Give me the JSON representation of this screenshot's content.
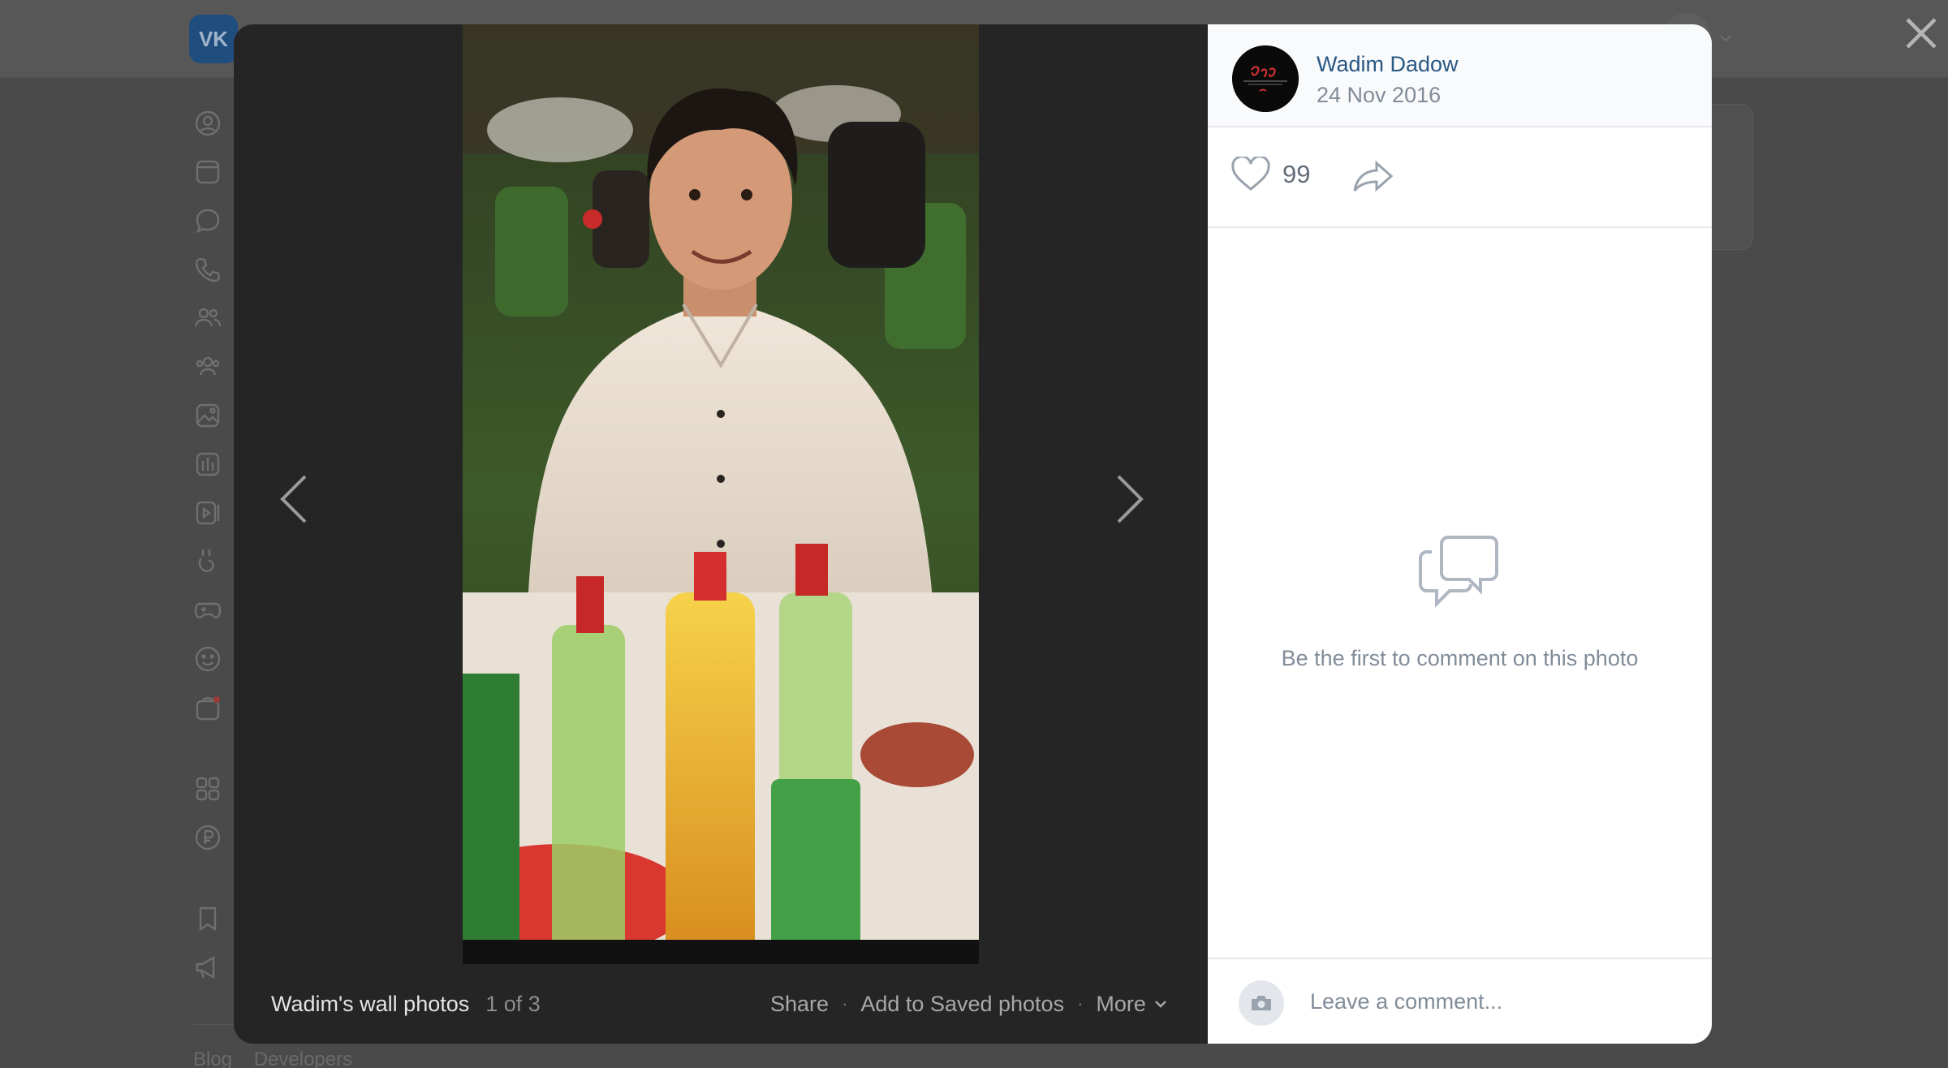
{
  "background": {
    "logo_text": "VK",
    "footer_links": [
      "Blog",
      "Developers"
    ]
  },
  "viewer": {
    "album_title": "Wadim's wall photos",
    "counter": "1 of 3",
    "actions": {
      "share": "Share",
      "save": "Add to Saved photos",
      "more": "More"
    },
    "author": {
      "name": "Wadim Dadow",
      "date": "24 Nov 2016"
    },
    "likes": "99",
    "empty_comments": "Be the first to comment on this photo",
    "comment_placeholder": "Leave a comment..."
  },
  "icons": {
    "nav": [
      "profile-icon",
      "news-icon",
      "messages-icon",
      "calls-icon",
      "friends-icon",
      "communities-icon",
      "photos-icon",
      "music-icon",
      "video-icon",
      "clips-icon",
      "games-icon",
      "stickers-icon",
      "market-icon",
      "services-icon",
      "payments-icon",
      "bookmarks-icon",
      "ads-icon"
    ]
  },
  "colors": {
    "link": "#2a5885",
    "muted": "#818c99",
    "overlay": "#252525"
  }
}
